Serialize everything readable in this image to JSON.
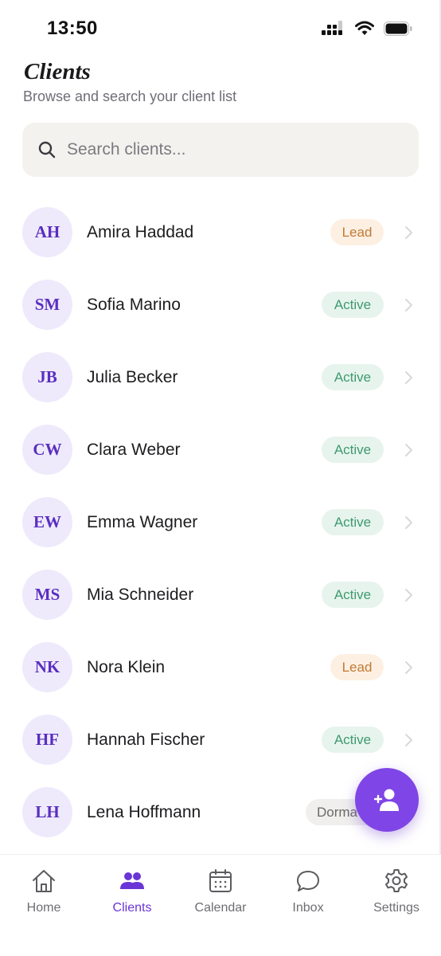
{
  "status_bar": {
    "time": "13:50"
  },
  "header": {
    "title": "Clients",
    "subtitle": "Browse and search your client list"
  },
  "search": {
    "placeholder": "Search clients..."
  },
  "clients": [
    {
      "initials": "AH",
      "name": "Amira Haddad",
      "status": "Lead"
    },
    {
      "initials": "SM",
      "name": "Sofia Marino",
      "status": "Active"
    },
    {
      "initials": "JB",
      "name": "Julia Becker",
      "status": "Active"
    },
    {
      "initials": "CW",
      "name": "Clara Weber",
      "status": "Active"
    },
    {
      "initials": "EW",
      "name": "Emma Wagner",
      "status": "Active"
    },
    {
      "initials": "MS",
      "name": "Mia Schneider",
      "status": "Active"
    },
    {
      "initials": "NK",
      "name": "Nora Klein",
      "status": "Lead"
    },
    {
      "initials": "HF",
      "name": "Hannah Fischer",
      "status": "Active"
    },
    {
      "initials": "LH",
      "name": "Lena Hoffmann",
      "status": "Dorma"
    }
  ],
  "fab": {
    "icon": "add-user-icon"
  },
  "nav": {
    "items": [
      {
        "label": "Home",
        "icon": "home-icon"
      },
      {
        "label": "Clients",
        "icon": "users-icon",
        "active": true
      },
      {
        "label": "Calendar",
        "icon": "calendar-icon"
      },
      {
        "label": "Inbox",
        "icon": "chat-icon"
      },
      {
        "label": "Settings",
        "icon": "gear-icon"
      }
    ]
  },
  "colors": {
    "accent": "#7f45e6",
    "avatar_bg": "#eeeafc",
    "lead_bg": "#fdf0e2",
    "lead_text": "#c07a35",
    "active_bg": "#e7f4ee",
    "active_text": "#3f9a6e"
  }
}
